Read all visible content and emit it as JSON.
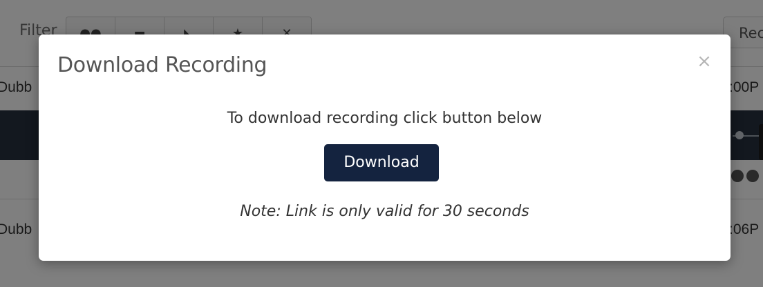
{
  "background": {
    "filter_label": "Filter",
    "filter_buttons": [
      {
        "icon": "sound-icon",
        "glyph": "●●"
      },
      {
        "icon": "email-icon",
        "glyph": "▬"
      },
      {
        "icon": "tag-icon",
        "glyph": "◣"
      },
      {
        "icon": "star-icon",
        "glyph": "★"
      },
      {
        "icon": "close-icon",
        "glyph": "✕"
      }
    ],
    "right_button_label": "Rec",
    "rows": [
      {
        "name": "Dubb",
        "time": ":00P"
      },
      {
        "name": "Dubb",
        "time": ":06P"
      }
    ]
  },
  "modal": {
    "title": "Download Recording",
    "close_label": "×",
    "message": "To download recording click button below",
    "download_label": "Download",
    "note": "Note: Link is only valid for 30 seconds"
  },
  "colors": {
    "download_button_bg": "#14233f",
    "backdrop": "rgba(0,0,0,0.5)",
    "player_strip": "#26313e"
  }
}
